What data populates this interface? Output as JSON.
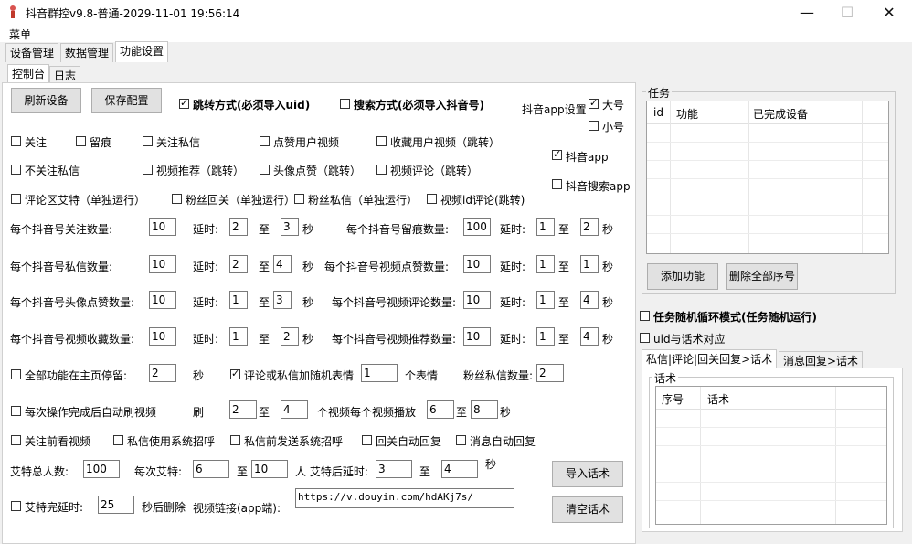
{
  "window": {
    "title": "抖音群控v9.8-普通-2029-11-01 19:56:14",
    "minimize": "—",
    "maximize": "☐",
    "close": "✕"
  },
  "menu": {
    "label": "菜单"
  },
  "main_tabs": [
    "设备管理",
    "数据管理",
    "功能设置"
  ],
  "sub_tabs": [
    "控制台",
    "日志"
  ],
  "buttons": {
    "refresh": "刷新设备",
    "save": "保存配置",
    "add_func": "添加功能",
    "delete_all": "删除全部序号",
    "import_script": "导入话术",
    "clear_script": "清空话术"
  },
  "mode": {
    "jump": "跳转方式(必须导入uid)",
    "search": "搜索方式(必须导入抖音号)"
  },
  "app_settings": {
    "label": "抖音app设置",
    "big": "大号",
    "small": "小号",
    "douyin_app": "抖音app",
    "douyin_search_app": "抖音搜索app"
  },
  "features_row1": [
    "关注",
    "留痕",
    "关注私信",
    "点赞用户视频",
    "收藏用户视频（跳转）"
  ],
  "features_row2": [
    "不关注私信",
    "视频推荐（跳转）",
    "头像点赞（跳转）",
    "视频评论（跳转）"
  ],
  "features_row3": [
    "评论区艾特（单独运行）",
    "粉丝回关（单独运行）",
    "粉丝私信（单独运行）",
    "视频id评论(跳转)"
  ],
  "labels": {
    "delay": "延时:",
    "to": "至",
    "sec": "秒"
  },
  "params": [
    {
      "left_label": "每个抖音号关注数量:",
      "left_val": "10",
      "ld1": "2",
      "ld2": "3",
      "right_label": "每个抖音号留痕数量:",
      "right_val": "100",
      "rd1": "1",
      "rd2": "2"
    },
    {
      "left_label": "每个抖音号私信数量:",
      "left_val": "10",
      "ld1": "2",
      "ld2": "4",
      "right_label": "每个抖音号视频点赞数量:",
      "right_val": "10",
      "rd1": "1",
      "rd2": "1"
    },
    {
      "left_label": "每个抖音号头像点赞数量:",
      "left_val": "10",
      "ld1": "1",
      "ld2": "3",
      "right_label": "每个抖音号视频评论数量:",
      "right_val": "10",
      "rd1": "1",
      "rd2": "4"
    },
    {
      "left_label": "每个抖音号视频收藏数量:",
      "left_val": "10",
      "ld1": "1",
      "ld2": "2",
      "right_label": "每个抖音号视频推荐数量:",
      "right_val": "10",
      "rd1": "1",
      "rd2": "4"
    }
  ],
  "homepage_stop": {
    "label": "全部功能在主页停留:",
    "value": "2",
    "unit": "秒"
  },
  "emoji": {
    "label": "评论或私信加随机表情",
    "value": "1",
    "unit": "个表情"
  },
  "fans_msg": {
    "label": "粉丝私信数量:",
    "value": "2"
  },
  "refresh_video": {
    "label": "每次操作完成后自动刷视频",
    "brush": "刷",
    "min": "2",
    "to": "至",
    "max": "4",
    "mid": "个视频每个视频播放",
    "pmin": "6",
    "pmax": "8",
    "unit": "秒"
  },
  "options_row": [
    "关注前看视频",
    "私信使用系统招呼",
    "私信前发送系统招呼",
    "回关自动回复",
    "消息自动回复"
  ],
  "aite": {
    "total_label": "艾特总人数:",
    "total": "100",
    "each_label": "每次艾特:",
    "each_min": "6",
    "to": "至",
    "each_max": "10",
    "after_label": "人 艾特后延时:",
    "after_min": "3",
    "after_to": "至",
    "after_max": "4",
    "unit": "秒"
  },
  "aite_done": {
    "label": "艾特完延时:",
    "value": "25",
    "suffix": "秒后删除"
  },
  "video_link": {
    "label": "视频链接(app端):",
    "value": "https://v.douyin.com/hdAKj7s/"
  },
  "tasks": {
    "title": "任务",
    "columns": [
      "id",
      "功能",
      "已完成设备"
    ]
  },
  "random_mode": "任务随机循环模式(任务随机运行)",
  "uid_map": "uid与话术对应",
  "script_tabs": [
    "私信|评论|回关回复>话术",
    "消息回复>话术"
  ],
  "scripts": {
    "title": "话术",
    "columns": [
      "序号",
      "话术"
    ]
  }
}
